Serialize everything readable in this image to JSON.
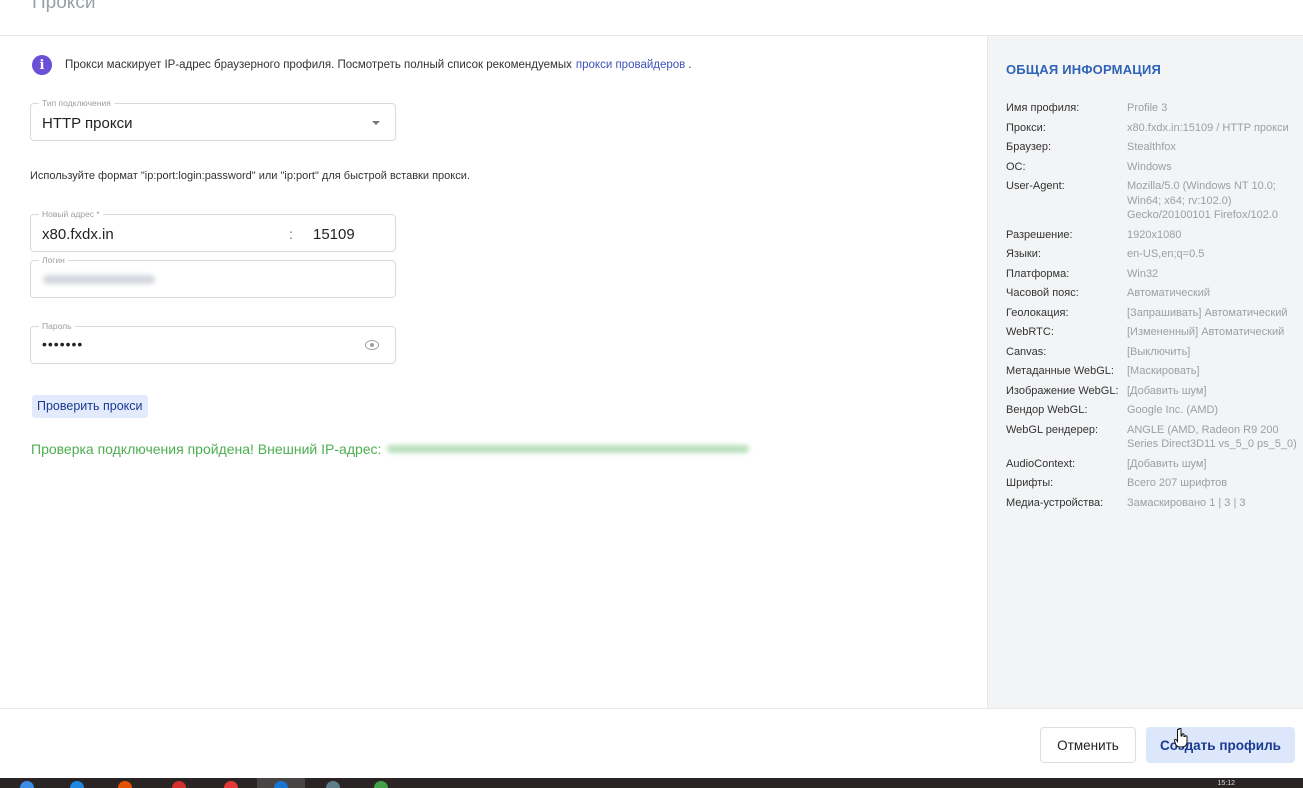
{
  "page": {
    "title": "Прокси"
  },
  "proxy": {
    "info_text": "Прокси маскирует IP-адрес браузерного профиля. Посмотреть полный список рекомендуемых",
    "info_link": "прокси провайдеров",
    "info_tail": ".",
    "connection_type_label": "Тип подключения",
    "connection_type_value": "HTTP прокси",
    "format_hint": "Используйте формат \"ip:port:login:password\" или \"ip:port\" для быстрой вставки прокси.",
    "address_label": "Новый адрес *",
    "address_value": "x80.fxdx.in",
    "address_separator": ":",
    "port_value": "15109",
    "login_label": "Логин",
    "password_label": "Пароль",
    "password_value": "•••••••",
    "check_button": "Проверить прокси",
    "success_text": "Проверка подключения пройдена! Внешний IP-адрес:"
  },
  "summary": {
    "title": "ОБЩАЯ ИНФОРМАЦИЯ",
    "rows": [
      {
        "label": "Имя профиля:",
        "value": "Profile 3"
      },
      {
        "label": "Прокси:",
        "value": "x80.fxdx.in:15109 / HTTP прокси"
      },
      {
        "label": "Браузер:",
        "value": "Stealthfox"
      },
      {
        "label": "ОС:",
        "value": "Windows"
      },
      {
        "label": "User-Agent:",
        "value": "Mozilla/5.0 (Windows NT 10.0; Win64; x64; rv:102.0) Gecko/20100101 Firefox/102.0"
      },
      {
        "label": "Разрешение:",
        "value": "1920x1080"
      },
      {
        "label": "Языки:",
        "value": "en-US,en;q=0.5"
      },
      {
        "label": "Платформа:",
        "value": "Win32"
      },
      {
        "label": "Часовой пояс:",
        "value": "Автоматический"
      },
      {
        "label": "Геолокация:",
        "value": "[Запрашивать] Автоматический"
      },
      {
        "label": "WebRTC:",
        "value": "[Измененный] Автоматический"
      },
      {
        "label": "Canvas:",
        "value": "[Выключить]"
      },
      {
        "label": "Метаданные WebGL:",
        "value": "[Маскировать]"
      },
      {
        "label": "Изображение WebGL:",
        "value": "[Добавить шум]"
      },
      {
        "label": "Вендор WebGL:",
        "value": "Google Inc. (AMD)"
      },
      {
        "label": "WebGL рендерер:",
        "value": "ANGLE (AMD, Radeon R9 200 Series Direct3D11 vs_5_0 ps_5_0)"
      },
      {
        "label": "AudioContext:",
        "value": "[Добавить шум]"
      },
      {
        "label": "Шрифты:",
        "value": "Всего 207 шрифтов"
      },
      {
        "label": "Медиа-устройства:",
        "value": "Замаскировано 1 | 3 | 3"
      }
    ]
  },
  "footer": {
    "cancel_button": "Отменить",
    "create_button": "Создать профиль"
  },
  "taskbar": {
    "clock": "15:12"
  },
  "colors": {
    "accent": "#2f63b6",
    "info_icon": "#6b4fd8",
    "success": "#4caf50",
    "link": "#3f51b5",
    "sidebar_bg": "#f3f4f6",
    "primary_button_bg": "#dce7fb"
  }
}
